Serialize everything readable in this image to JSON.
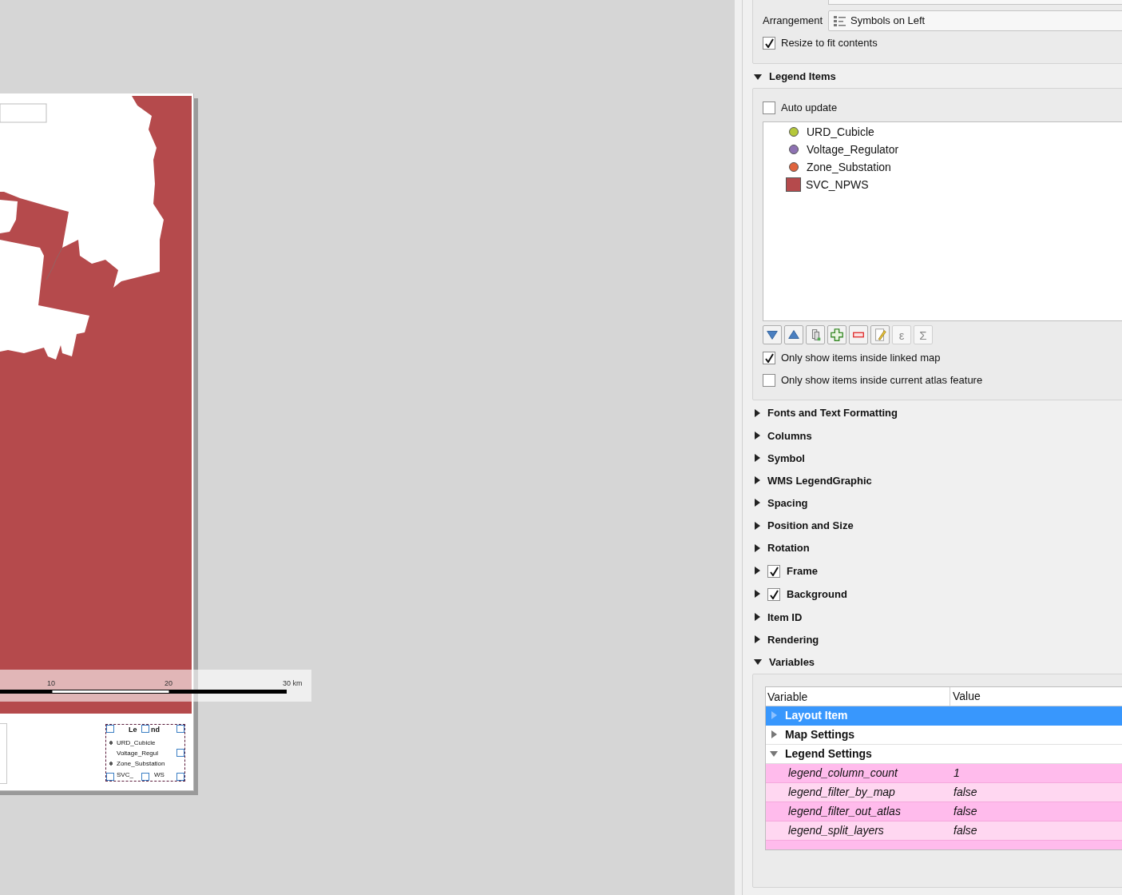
{
  "layout_canvas": {
    "scale_bar": {
      "labels": [
        "10",
        "20",
        "30 km"
      ]
    },
    "legend_preview": {
      "title_parts": [
        "Le",
        "nd"
      ],
      "items": [
        {
          "label": "URD_Cubicle",
          "symbol": true
        },
        {
          "label": "Voltage_Regul",
          "symbol": false
        },
        {
          "label": "Zone_Substation",
          "symbol": true
        },
        {
          "label": "SVC_",
          "symbol": false
        },
        {
          "label": "WS",
          "symbol": false
        }
      ]
    }
  },
  "item_properties": {
    "arrangement": {
      "label": "Arrangement",
      "value": "Symbols on Left"
    },
    "resize_to_fit": {
      "label": "Resize to fit contents",
      "checked": true
    },
    "legend_items": {
      "title": "Legend Items",
      "expanded": true,
      "auto_update": {
        "label": "Auto update",
        "checked": false
      },
      "items": [
        {
          "label": "URD_Cubicle",
          "kind": "point",
          "color": "#b5c83a"
        },
        {
          "label": "Voltage_Regulator",
          "kind": "point",
          "color": "#8e72b3"
        },
        {
          "label": "Zone_Substation",
          "kind": "point",
          "color": "#e0643e"
        },
        {
          "label": "SVC_NPWS",
          "kind": "fill",
          "color": "#b54a4c"
        }
      ],
      "toolbar": [
        {
          "kind": "down",
          "disabled": false
        },
        {
          "kind": "up",
          "disabled": false
        },
        {
          "kind": "group",
          "disabled": false
        },
        {
          "kind": "add",
          "disabled": false
        },
        {
          "kind": "remove",
          "disabled": false
        },
        {
          "kind": "edit",
          "disabled": false
        },
        {
          "kind": "text",
          "label": "ε",
          "disabled": true
        },
        {
          "kind": "text",
          "label": "Σ",
          "disabled": true
        }
      ],
      "options": [
        {
          "label": "Only show items inside linked map",
          "checked": true
        },
        {
          "label": "Only show items inside current atlas feature",
          "checked": false
        }
      ]
    },
    "sections": [
      {
        "title": "Fonts and Text Formatting",
        "kind": "plain",
        "expanded": false
      },
      {
        "title": "Columns",
        "kind": "plain",
        "expanded": false
      },
      {
        "title": "Symbol",
        "kind": "plain",
        "expanded": false
      },
      {
        "title": "WMS LegendGraphic",
        "kind": "plain",
        "expanded": false
      },
      {
        "title": "Spacing",
        "kind": "plain",
        "expanded": false
      },
      {
        "title": "Position and Size",
        "kind": "plain",
        "expanded": false
      },
      {
        "title": "Rotation",
        "kind": "plain",
        "expanded": false
      },
      {
        "title": "Frame",
        "kind": "checkbox",
        "checked": true,
        "expanded": false
      },
      {
        "title": "Background",
        "kind": "checkbox",
        "checked": true,
        "expanded": false
      },
      {
        "title": "Item ID",
        "kind": "plain",
        "expanded": false
      },
      {
        "title": "Rendering",
        "kind": "plain",
        "expanded": false
      },
      {
        "title": "Variables",
        "kind": "plain",
        "expanded": true
      }
    ],
    "variables": {
      "columns": [
        "Variable",
        "Value"
      ],
      "rows": [
        {
          "kind": "group",
          "name": "Layout Item",
          "expanded": false,
          "selected": true
        },
        {
          "kind": "group",
          "name": "Map Settings",
          "expanded": false,
          "selected": false
        },
        {
          "kind": "group",
          "name": "Legend Settings",
          "expanded": true,
          "selected": false
        },
        {
          "kind": "variable",
          "name": "legend_column_count",
          "value": "1"
        },
        {
          "kind": "variable",
          "name": "legend_filter_by_map",
          "value": "false"
        },
        {
          "kind": "variable",
          "name": "legend_filter_out_atlas",
          "value": "false"
        },
        {
          "kind": "variable",
          "name": "legend_split_layers",
          "value": "false"
        }
      ]
    }
  }
}
